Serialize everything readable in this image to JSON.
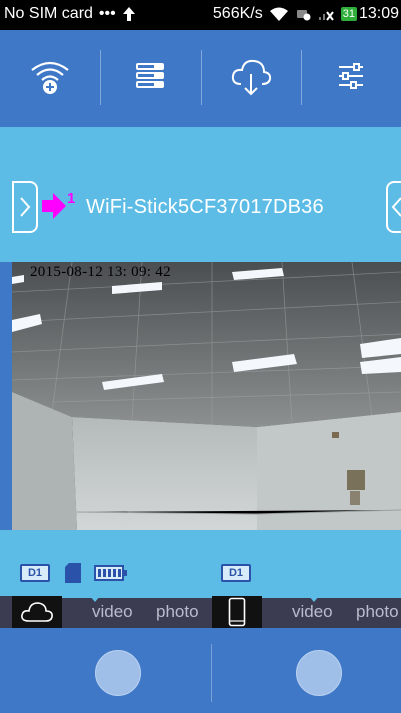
{
  "status_bar": {
    "carrier": "No SIM card",
    "speed": "566K/s",
    "battery_level": "31",
    "time": "13:09"
  },
  "toolbar": {
    "items": [
      {
        "name": "wifi-add-icon"
      },
      {
        "name": "list-menu-icon"
      },
      {
        "name": "cloud-download-icon"
      },
      {
        "name": "settings-sliders-icon"
      }
    ]
  },
  "device": {
    "index": "1",
    "name": "WiFi-Stick5CF37017DB36"
  },
  "camera": {
    "timestamp": "2015-08-12 13: 09: 42"
  },
  "status_icons": {
    "cloud_resolution": "D1",
    "local_resolution": "D1"
  },
  "tabs": {
    "cloud_video": "video",
    "cloud_photo": "photo",
    "phone_video": "video",
    "phone_photo": "photo"
  },
  "colors": {
    "primary_blue": "#3f78c6",
    "light_blue": "#5dbce6",
    "accent_magenta": "#ff00ff"
  }
}
